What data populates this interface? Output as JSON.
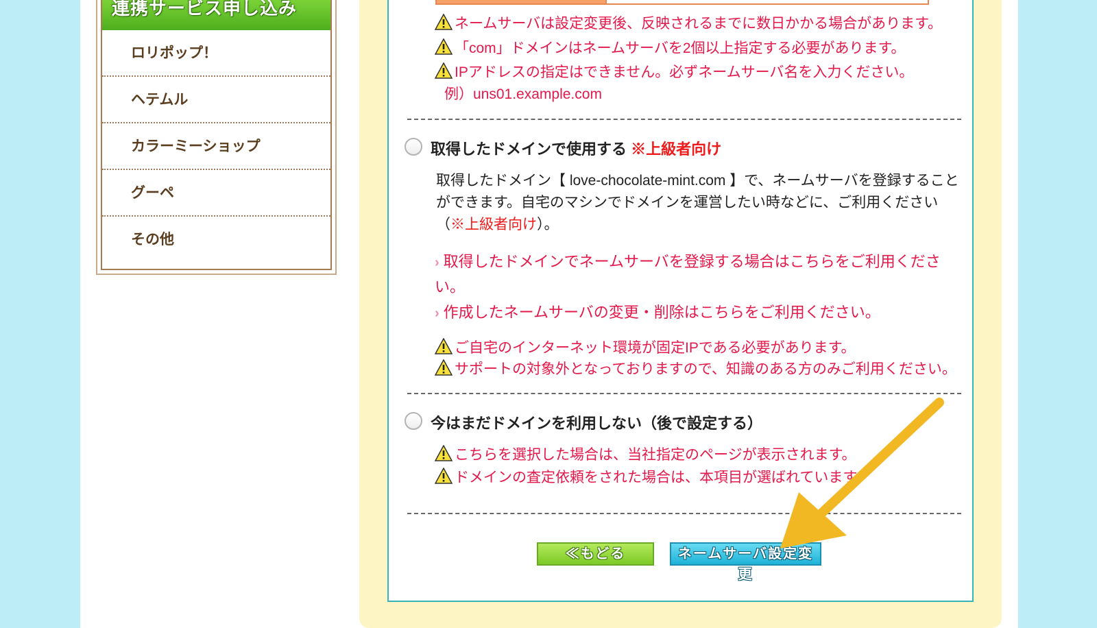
{
  "sidebar": {
    "header": "連携サービス申し込み",
    "items": [
      {
        "label": "ロリポップ！"
      },
      {
        "label": "ヘテムル"
      },
      {
        "label": "カラーミーショップ"
      },
      {
        "label": "グーペ"
      },
      {
        "label": "その他"
      }
    ]
  },
  "warnings_top": [
    "ネームサーバは設定変更後、反映されるまでに数日かかる場合があります。",
    "「com」ドメインはネームサーバを2個以上指定する必要があります。",
    "IPアドレスの指定はできません。必ずネームサーバ名を入力ください。"
  ],
  "example_text": "例）uns01.example.com",
  "option_own": {
    "title": "取得したドメインで使用する",
    "badge": "※上級者向け",
    "desc_before": "取得したドメイン【 love-chocolate-mint.com 】で、ネームサーバを登録することができます。自宅のマシンでドメインを運営したい時などに、ご利用ください（",
    "desc_red": "※上級者向け",
    "desc_after": "）。",
    "links": [
      "取得したドメインでネームサーバを登録する場合はこちらをご利用ください。",
      "作成したネームサーバの変更・削除はこちらをご利用ください。"
    ],
    "warnings": [
      "ご自宅のインターネット環境が固定IPである必要があります。",
      "サポートの対象外となっておりますので、知識のある方のみご利用ください。"
    ]
  },
  "option_later": {
    "title": "今はまだドメインを利用しない（後で設定する）",
    "warnings": [
      "こちらを選択した場合は、当社指定のページが表示されます。",
      "ドメインの査定依頼をされた場合は、本項目が選ばれています。"
    ]
  },
  "buttons": {
    "back": "≪もどる",
    "submit": "ネームサーバ設定変更"
  },
  "colors": {
    "warning_text": "#e3194b",
    "arrow": "#f2b824",
    "frame": "#35b3b8"
  }
}
